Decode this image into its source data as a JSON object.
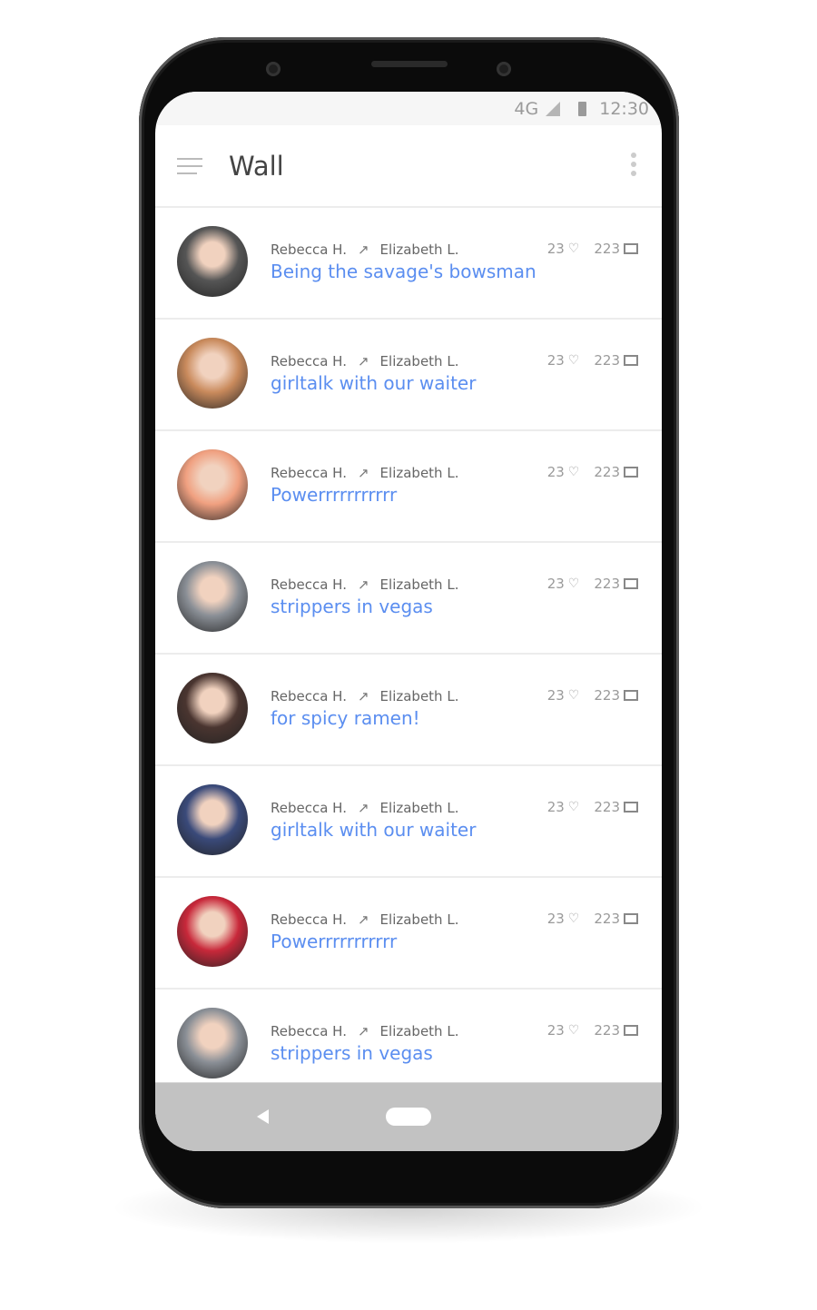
{
  "status_bar": {
    "network": "4G",
    "time": "12:30"
  },
  "header": {
    "title": "Wall",
    "menu_icon": "hamburger-icon",
    "more_icon": "more-vertical-icon"
  },
  "posts": [
    {
      "from": "Rebecca H.",
      "to": "Elizabeth L.",
      "message": "Being the savage's bowsman",
      "likes": "23",
      "comments": "223",
      "avatar_color": "#555555"
    },
    {
      "from": "Rebecca H.",
      "to": "Elizabeth L.",
      "message": "girltalk with our waiter",
      "likes": "23",
      "comments": "223",
      "avatar_color": "#c98a5c"
    },
    {
      "from": "Rebecca H.",
      "to": "Elizabeth L.",
      "message": "Powerrrrrrrrrrr",
      "likes": "23",
      "comments": "223",
      "avatar_color": "#f0a080"
    },
    {
      "from": "Rebecca H.",
      "to": "Elizabeth L.",
      "message": "strippers in vegas",
      "likes": "23",
      "comments": "223",
      "avatar_color": "#8a8f96"
    },
    {
      "from": "Rebecca H.",
      "to": "Elizabeth L.",
      "message": "for spicy ramen!",
      "likes": "23",
      "comments": "223",
      "avatar_color": "#4a3530"
    },
    {
      "from": "Rebecca H.",
      "to": "Elizabeth L.",
      "message": "girltalk with our waiter",
      "likes": "23",
      "comments": "223",
      "avatar_color": "#3a4a7a"
    },
    {
      "from": "Rebecca H.",
      "to": "Elizabeth L.",
      "message": "Powerrrrrrrrrrr",
      "likes": "23",
      "comments": "223",
      "avatar_color": "#c8283a"
    },
    {
      "from": "Rebecca H.",
      "to": "Elizabeth L.",
      "message": "strippers in vegas",
      "likes": "23",
      "comments": "223",
      "avatar_color": "#8a8f96"
    }
  ],
  "colors": {
    "accent": "#5b8ef0",
    "navbar": "#c2c2c2"
  }
}
